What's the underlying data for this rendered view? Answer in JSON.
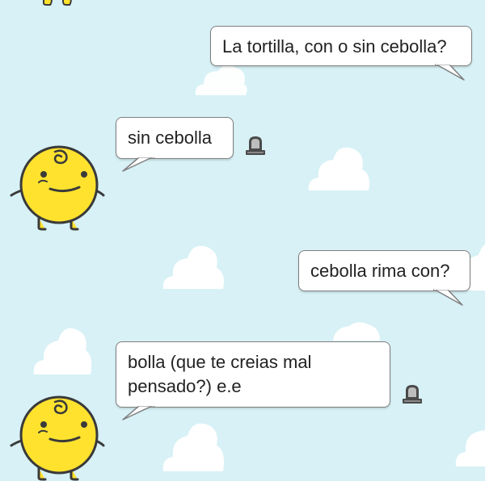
{
  "chat": {
    "messages": [
      {
        "sender": "user",
        "text": "La tortilla, con o sin cebolla?"
      },
      {
        "sender": "simsimi",
        "text": "sin cebolla"
      },
      {
        "sender": "user",
        "text": "cebolla rima con?"
      },
      {
        "sender": "simsimi",
        "text": "bolla (que te creias mal pensado?) e.e"
      }
    ]
  },
  "colors": {
    "background": "#d7f1f6",
    "bubble": "#ffffff",
    "bubble_border": "#7e7e7e",
    "avatar_yellow": "#ffe22e",
    "cloud": "#ffffff"
  },
  "icons": {
    "avatar": "simsimi-avatar-icon",
    "report": "siren-icon"
  }
}
